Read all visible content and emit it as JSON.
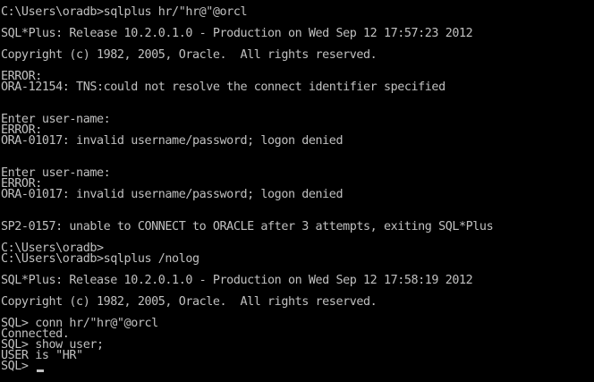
{
  "console": {
    "text_color": "#c0c0c0",
    "background_color": "#000000",
    "lines": [
      "C:\\Users\\oradb>sqlplus hr/\"hr@\"@orcl",
      "",
      "SQL*Plus: Release 10.2.0.1.0 - Production on Wed Sep 12 17:57:23 2012",
      "",
      "Copyright (c) 1982, 2005, Oracle.  All rights reserved.",
      "",
      "ERROR:",
      "ORA-12154: TNS:could not resolve the connect identifier specified",
      "",
      "",
      "Enter user-name:",
      "ERROR:",
      "ORA-01017: invalid username/password; logon denied",
      "",
      "",
      "Enter user-name:",
      "ERROR:",
      "ORA-01017: invalid username/password; logon denied",
      "",
      "",
      "SP2-0157: unable to CONNECT to ORACLE after 3 attempts, exiting SQL*Plus",
      "",
      "C:\\Users\\oradb>",
      "C:\\Users\\oradb>sqlplus /nolog",
      "",
      "SQL*Plus: Release 10.2.0.1.0 - Production on Wed Sep 12 17:58:19 2012",
      "",
      "Copyright (c) 1982, 2005, Oracle.  All rights reserved.",
      "",
      "SQL> conn hr/\"hr@\"@orcl",
      "Connected.",
      "SQL> show user;",
      "USER is \"HR\"",
      "SQL> "
    ]
  }
}
